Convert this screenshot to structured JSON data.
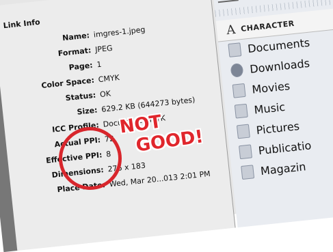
{
  "link_info": {
    "header": "Link Info",
    "rows": [
      {
        "label": "Name:",
        "value": "imgres-1.jpeg"
      },
      {
        "label": "Format:",
        "value": "JPEG"
      },
      {
        "label": "Page:",
        "value": "1"
      },
      {
        "label": "Color Space:",
        "value": "CMYK"
      },
      {
        "label": "Status:",
        "value": "OK"
      },
      {
        "label": "Size:",
        "value": "629.2 KB (644273 bytes)"
      },
      {
        "label": "ICC Profile:",
        "value": "Document CMYK"
      },
      {
        "label": "Actual PPI:",
        "value": "72"
      },
      {
        "label": "Effective PPI:",
        "value": "8"
      },
      {
        "label": "Dimensions:",
        "value": "276 x 183"
      },
      {
        "label": "Place Date:",
        "value": "Wed, Mar 20...013 2:01 PM"
      }
    ]
  },
  "sidebar": {
    "panel_label": "CHARACTER",
    "panel_icon": "A",
    "items": [
      {
        "label": "Documents",
        "icon": "folder-icon"
      },
      {
        "label": "Downloads",
        "icon": "downloads-icon"
      },
      {
        "label": "Movies",
        "icon": "folder-icon"
      },
      {
        "label": "Music",
        "icon": "folder-icon"
      },
      {
        "label": "Pictures",
        "icon": "folder-icon"
      },
      {
        "label": "Publicatio",
        "icon": "folder-icon"
      },
      {
        "label": "Magazin",
        "icon": "folder-icon"
      }
    ]
  },
  "annotation": {
    "line1": "NOT",
    "line2": "GOOD!",
    "color": "#e0262c"
  }
}
